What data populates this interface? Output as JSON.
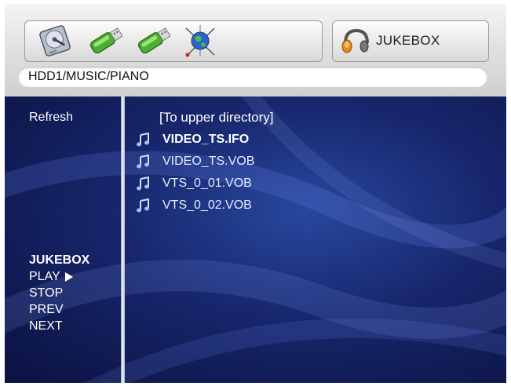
{
  "header": {
    "devices": [
      {
        "icon": "hard-disk-icon"
      },
      {
        "icon": "usb-drive-icon"
      },
      {
        "icon": "usb-drive-icon"
      },
      {
        "icon": "network-globe-icon"
      }
    ],
    "mode": {
      "icon": "headphones-icon",
      "label": "JUKEBOX"
    },
    "path": "HDD1/MUSIC/PIANO"
  },
  "sidebar": {
    "refresh_label": "Refresh",
    "controls": {
      "title": "JUKEBOX",
      "play": "PLAY",
      "stop": "STOP",
      "prev": "PREV",
      "next": "NEXT"
    }
  },
  "browser": {
    "up_label": "[To upper directory]",
    "files": [
      {
        "name": "VIDEO_TS.IFO",
        "selected": true
      },
      {
        "name": "VIDEO_TS.VOB",
        "selected": false
      },
      {
        "name": "VTS_0_01.VOB",
        "selected": false
      },
      {
        "name": "VTS_0_02.VOB",
        "selected": false
      }
    ]
  },
  "colors": {
    "background": "#17266c",
    "divider": "#f4f6ff",
    "usb_green": "#4caf2f"
  }
}
